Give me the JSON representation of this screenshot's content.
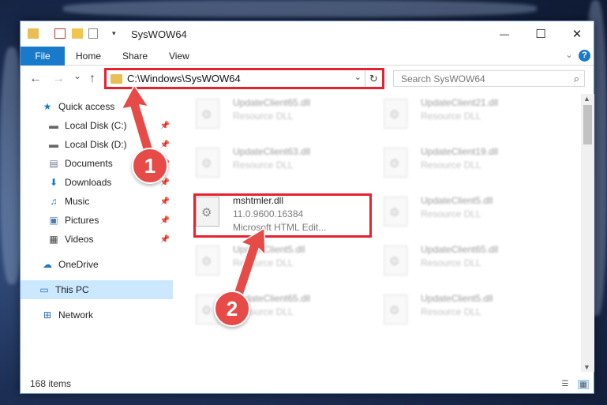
{
  "window": {
    "title": "SysWOW64",
    "minimize_glyph": "—",
    "maximize_glyph": "☐",
    "close_glyph": "✕"
  },
  "ribbon": {
    "file": "File",
    "tabs": [
      "Home",
      "Share",
      "View"
    ],
    "help": "?"
  },
  "navigation": {
    "back": "←",
    "forward": "→",
    "recent": "⌄",
    "up": "↑",
    "address": "C:\\Windows\\SysWOW64",
    "search_placeholder": "Search SysWOW64"
  },
  "sidebar": {
    "items": [
      {
        "label": "Quick access",
        "icon": "star-icon",
        "glyph": "★",
        "color": "#1979ca",
        "pinned": false
      },
      {
        "label": "Local Disk (C:)",
        "icon": "drive-icon",
        "glyph": "▬",
        "color": "#666666",
        "pinned": true
      },
      {
        "label": "Local Disk (D:)",
        "icon": "drive-icon",
        "glyph": "▬",
        "color": "#666666",
        "pinned": true
      },
      {
        "label": "Documents",
        "icon": "documents-icon",
        "glyph": "▤",
        "color": "#6c7a89",
        "pinned": true
      },
      {
        "label": "Downloads",
        "icon": "downloads-icon",
        "glyph": "⬇",
        "color": "#1979ca",
        "pinned": true
      },
      {
        "label": "Music",
        "icon": "music-icon",
        "glyph": "♫",
        "color": "#1979ca",
        "pinned": true
      },
      {
        "label": "Pictures",
        "icon": "pictures-icon",
        "glyph": "▣",
        "color": "#4a7bb7",
        "pinned": true
      },
      {
        "label": "Videos",
        "icon": "videos-icon",
        "glyph": "▦",
        "color": "#444444",
        "pinned": true
      },
      {
        "label": "OneDrive",
        "icon": "onedrive-icon",
        "glyph": "☁",
        "color": "#1979ca",
        "pinned": false
      },
      {
        "label": "This PC",
        "icon": "computer-icon",
        "glyph": "▭",
        "color": "#2a6db0",
        "pinned": false,
        "selected": true
      },
      {
        "label": "Network",
        "icon": "network-icon",
        "glyph": "⊞",
        "color": "#2a6db0",
        "pinned": false
      }
    ]
  },
  "files": {
    "left_column": [
      {
        "name": "UpdateClient65.dll",
        "type": "Resource DLL"
      },
      {
        "name": "UpdateClient63.dll",
        "type": "Resource DLL"
      },
      {
        "name": "mshtmler.dll",
        "version": "11.0.9600.16384",
        "description": "Microsoft HTML Edit..."
      },
      {
        "name": "UpdateClient5.dll",
        "type": "Resource DLL"
      },
      {
        "name": "UpdateClient65.dll",
        "type": "Resource DLL"
      }
    ],
    "right_column": [
      {
        "name": "UpdateClient21.dll",
        "type": "Resource DLL"
      },
      {
        "name": "UpdateClient19.dll",
        "type": "Resource DLL"
      },
      {
        "name": "UpdateClient5.dll",
        "type": "Resource DLL"
      },
      {
        "name": "UpdateClient65.dll",
        "type": "Resource DLL"
      },
      {
        "name": "UpdateClient5.dll",
        "type": "Resource DLL"
      }
    ]
  },
  "status": {
    "item_count": "168 items"
  },
  "annotations": {
    "step1": "1",
    "step2": "2",
    "color": "#e8212f"
  }
}
